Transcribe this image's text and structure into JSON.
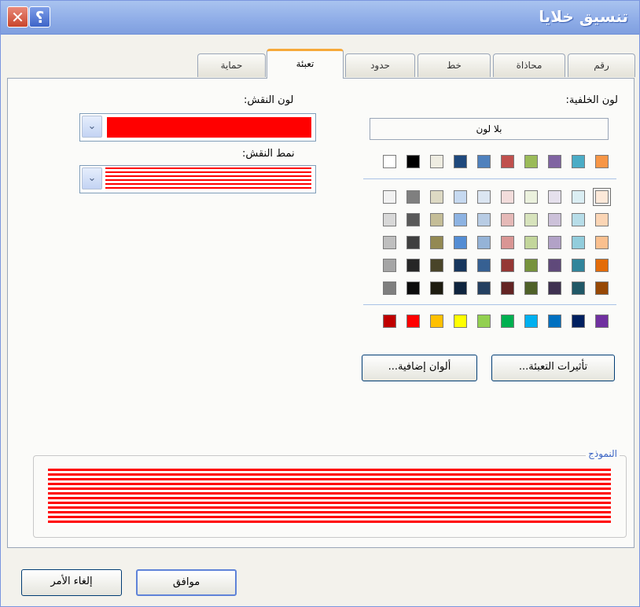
{
  "window": {
    "title": "تنسيق خلايا",
    "close_icon": "close-icon",
    "help_icon": "help-icon"
  },
  "tabs": [
    "رقم",
    "محاذاة",
    "خط",
    "حدود",
    "تعبئة",
    "حماية"
  ],
  "active_tab": "تعبئة",
  "background_color": {
    "label": "لون الخلفية:",
    "no_color_label": "بلا لون",
    "top_row": [
      "#f79646",
      "#4bacc6",
      "#8064a2",
      "#9bbb59",
      "#c0504d",
      "#4f81bd",
      "#1f497d",
      "#eeece1",
      "#000000",
      "#ffffff"
    ],
    "shade_rows": [
      [
        "#fde9d9",
        "#dbeef3",
        "#e5e0ec",
        "#ebf1dd",
        "#f2dcdb",
        "#dbe5f1",
        "#c6d9f0",
        "#ddd9c3",
        "#7f7f7f",
        "#f2f2f2"
      ],
      [
        "#fbd5b5",
        "#b7dde8",
        "#ccc1d9",
        "#d7e3bc",
        "#e5b9b7",
        "#b8cce4",
        "#8db3e2",
        "#c4bd97",
        "#595959",
        "#d8d8d8"
      ],
      [
        "#fac08f",
        "#92cddc",
        "#b2a2c7",
        "#c3d69b",
        "#d99694",
        "#95b3d7",
        "#548dd4",
        "#938953",
        "#3f3f3f",
        "#bfbfbf"
      ],
      [
        "#e36c09",
        "#31859b",
        "#5f497a",
        "#76923c",
        "#953734",
        "#366092",
        "#17365d",
        "#494429",
        "#262626",
        "#a5a5a5"
      ],
      [
        "#974806",
        "#205867",
        "#3f3151",
        "#4f6128",
        "#632423",
        "#244061",
        "#0f243e",
        "#1d1b10",
        "#0c0c0c",
        "#7f7f7f"
      ]
    ],
    "standard_row": [
      "#7030a0",
      "#002060",
      "#0070c0",
      "#00b0f0",
      "#00b050",
      "#92d050",
      "#ffff00",
      "#ffc000",
      "#ff0000",
      "#c00000"
    ],
    "selected": "#fde9d9"
  },
  "pattern_color": {
    "label": "لون النقش:",
    "value": "#ff0000"
  },
  "pattern_style": {
    "label": "نمط النقش:"
  },
  "buttons": {
    "fill_effects": "تأثيرات التعبئة...",
    "more_colors": "ألوان إضافية..."
  },
  "sample": {
    "label": "النموذج"
  },
  "footer": {
    "ok": "موافق",
    "cancel": "إلغاء الأمر"
  }
}
